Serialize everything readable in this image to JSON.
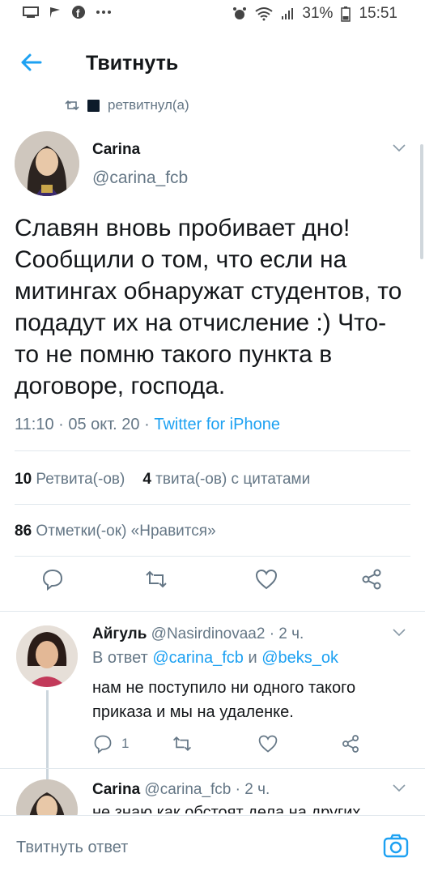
{
  "status_bar": {
    "battery": "31%",
    "time": "15:51",
    "left_icons": [
      "screen-icon",
      "flag-icon",
      "facebook-icon",
      "more-icon"
    ],
    "right_icons": [
      "alarm-icon",
      "wifi-icon",
      "signal-icon",
      "battery-icon"
    ]
  },
  "header": {
    "title": "Твитнуть"
  },
  "retweet": {
    "text": "ретвитнул(а)"
  },
  "tweet": {
    "author_name": "Carina",
    "author_handle": "@carina_fcb",
    "text": "Славян вновь пробивает дно! Сообщили о том, что если на митингах обнаружат студентов, то подадут их на отчисление :) Что-то не помню такого пункта в договоре, господа.",
    "meta_time": "11:10 · 05 окт. 20 · ",
    "meta_source": "Twitter for iPhone",
    "retweets_count": "10",
    "retweets_label": "Ретвита(-ов)",
    "quotes_count": "4",
    "quotes_label": "твита(-ов) с цитатами",
    "likes_count": "86",
    "likes_label": "Отметки(-ок) «Нравится»"
  },
  "reply1": {
    "name": "Айгуль",
    "handle_time": "@Nasirdinovaa2 · 2 ч.",
    "reply_prefix": "В ответ ",
    "mention1": "@carina_fcb",
    "and": " и ",
    "mention2": "@beks_ok",
    "text": "нам не поступило ни одного такого приказа и мы на удаленке.",
    "reply_count": "1"
  },
  "reply2": {
    "name": "Carina",
    "handle_time": "@carina_fcb · 2 ч.",
    "text": "не знаю как обстоят дела на других"
  },
  "compose": {
    "placeholder": "Твитнуть ответ"
  },
  "colors": {
    "accent": "#1da1f2",
    "secondary_text": "#657786",
    "divider": "#e1e8ed"
  }
}
